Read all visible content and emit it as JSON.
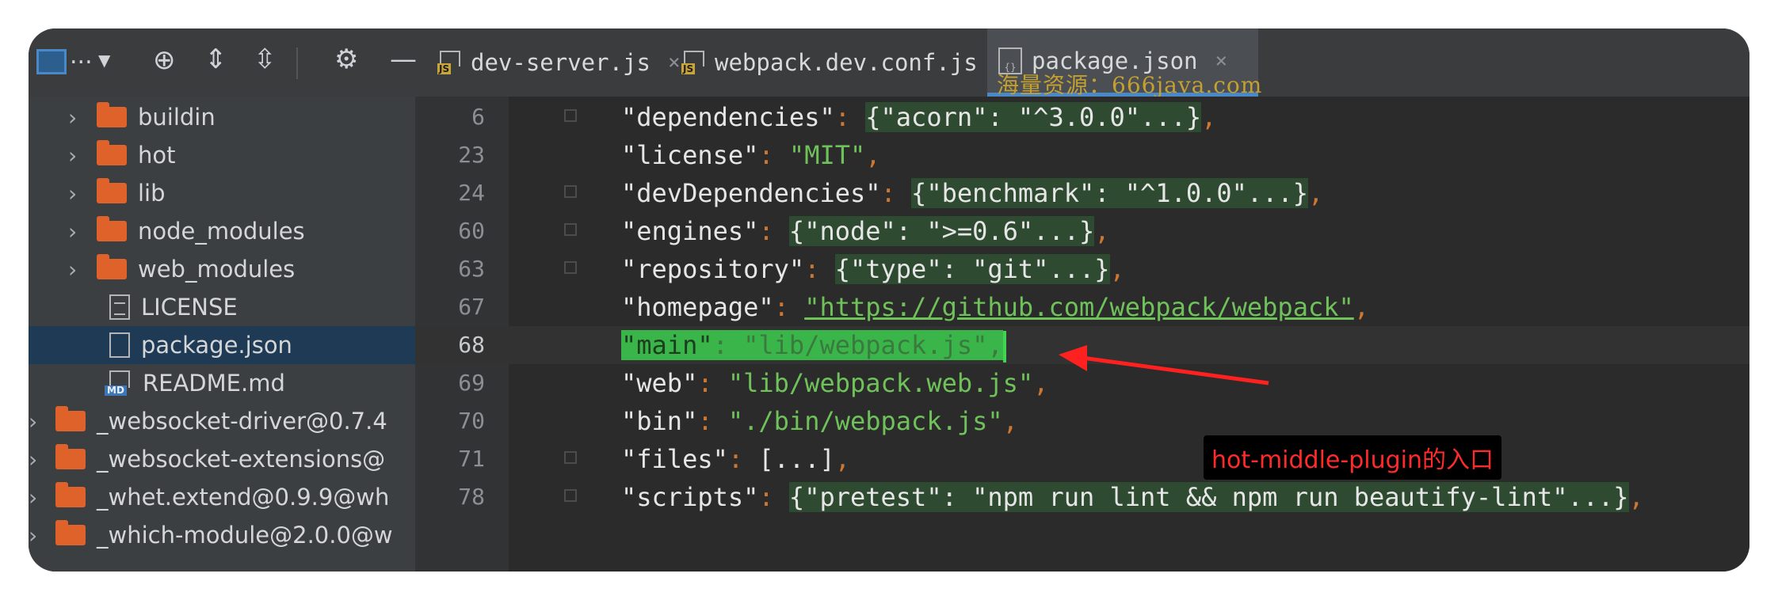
{
  "toolbar": {
    "project_label": "...",
    "icons": [
      "window-icon",
      "dropdown-icon",
      "target-icon",
      "expand-icon",
      "collapse-icon",
      "gear-icon",
      "minus-icon"
    ]
  },
  "tabs": [
    {
      "label": "dev-server.js",
      "icon": "js-file-icon",
      "icon_text": "JS",
      "close": "×",
      "active": false
    },
    {
      "label": "webpack.dev.conf.js",
      "icon": "js-file-icon",
      "icon_text": "JS",
      "close": "×",
      "active": false
    },
    {
      "label": "package.json",
      "icon": "json-file-icon",
      "icon_text": "{}",
      "close": "×",
      "active": true
    }
  ],
  "watermark": "海量资源：666java.com",
  "sidebar": {
    "items": [
      {
        "label": "buildin",
        "type": "folder",
        "expandable": true
      },
      {
        "label": "hot",
        "type": "folder",
        "expandable": true
      },
      {
        "label": "lib",
        "type": "folder",
        "expandable": true
      },
      {
        "label": "node_modules",
        "type": "folder",
        "expandable": true
      },
      {
        "label": "web_modules",
        "type": "folder",
        "expandable": true
      },
      {
        "label": "LICENSE",
        "type": "text-file"
      },
      {
        "label": "package.json",
        "type": "json-file",
        "selected": true
      },
      {
        "label": "README.md",
        "type": "md-file",
        "icon_text": "MD"
      },
      {
        "label": "_websocket-driver@0.7.4",
        "type": "folder",
        "expandable": true
      },
      {
        "label": "_websocket-extensions@",
        "type": "folder",
        "expandable": true
      },
      {
        "label": "_whet.extend@0.9.9@wh",
        "type": "folder",
        "expandable": true
      },
      {
        "label": "_which-module@2.0.0@w",
        "type": "folder",
        "expandable": true
      }
    ]
  },
  "editor": {
    "lines": [
      {
        "num": "6",
        "key": "\"dependencies\"",
        "value": "{\"acorn\": \"^3.0.0\"...}",
        "kind": "fold"
      },
      {
        "num": "23",
        "key": "\"license\"",
        "value": "\"MIT\"",
        "kind": "string"
      },
      {
        "num": "24",
        "key": "\"devDependencies\"",
        "value": "{\"benchmark\": \"^1.0.0\"...}",
        "kind": "fold"
      },
      {
        "num": "60",
        "key": "\"engines\"",
        "value": "{\"node\": \">=0.6\"...}",
        "kind": "fold"
      },
      {
        "num": "63",
        "key": "\"repository\"",
        "value": "{\"type\": \"git\"...}",
        "kind": "fold"
      },
      {
        "num": "67",
        "key": "\"homepage\"",
        "value": "\"https://github.com/webpack/webpack\"",
        "kind": "url"
      },
      {
        "num": "68",
        "key": "\"main\"",
        "value": "\"lib/webpack.js\"",
        "kind": "selected"
      },
      {
        "num": "69",
        "key": "\"web\"",
        "value": "\"lib/webpack.web.js\"",
        "kind": "string"
      },
      {
        "num": "70",
        "key": "\"bin\"",
        "value": "\"./bin/webpack.js\"",
        "kind": "string"
      },
      {
        "num": "71",
        "key": "\"files\"",
        "value": "[...]",
        "kind": "plain"
      },
      {
        "num": "78",
        "key": "\"scripts\"",
        "value": "{\"pretest\": \"npm run lint && npm run beautify-lint\"...}",
        "kind": "fold"
      }
    ],
    "colon": ": ",
    "comma": ","
  },
  "annotation": {
    "text": "hot-middle-plugin的入口",
    "color": "#ff2a2a"
  }
}
